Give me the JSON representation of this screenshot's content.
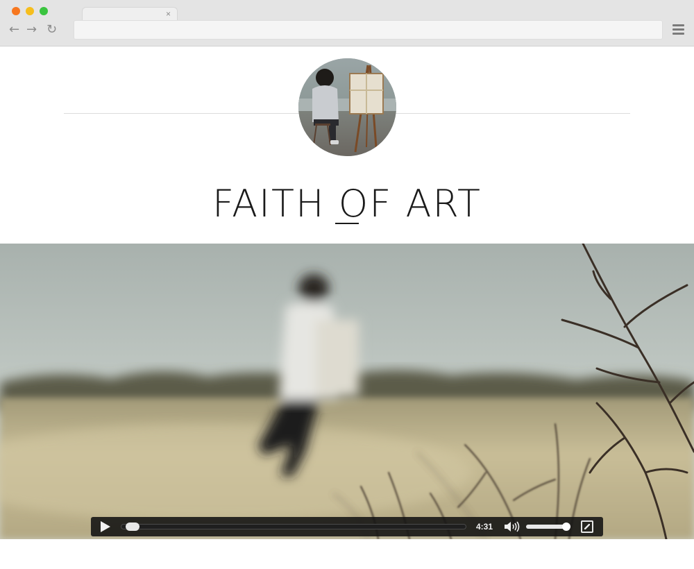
{
  "browser": {
    "tab_close_glyph": "×",
    "nav_back_glyph": "←",
    "nav_forward_glyph": "→",
    "nav_reload_glyph": "↻",
    "address_value": "",
    "traffic_colors": {
      "close": "#f7771f",
      "minimize": "#f6be1d",
      "zoom": "#3ac43f"
    }
  },
  "header": {
    "site_title": "FAITH OF ART",
    "avatar_alt": "profile-photo-painter-at-easel"
  },
  "video": {
    "current_time": "4:31",
    "progress": 0.01,
    "volume": 0.9,
    "icons": {
      "play": "play-icon",
      "volume": "volume-icon",
      "fullscreen": "fullscreen-icon"
    }
  },
  "colors": {
    "title_text": "#1a1a1a",
    "controls_bg": "#121212",
    "sky": "#b7c0bc",
    "field": "#c9bf9a"
  }
}
